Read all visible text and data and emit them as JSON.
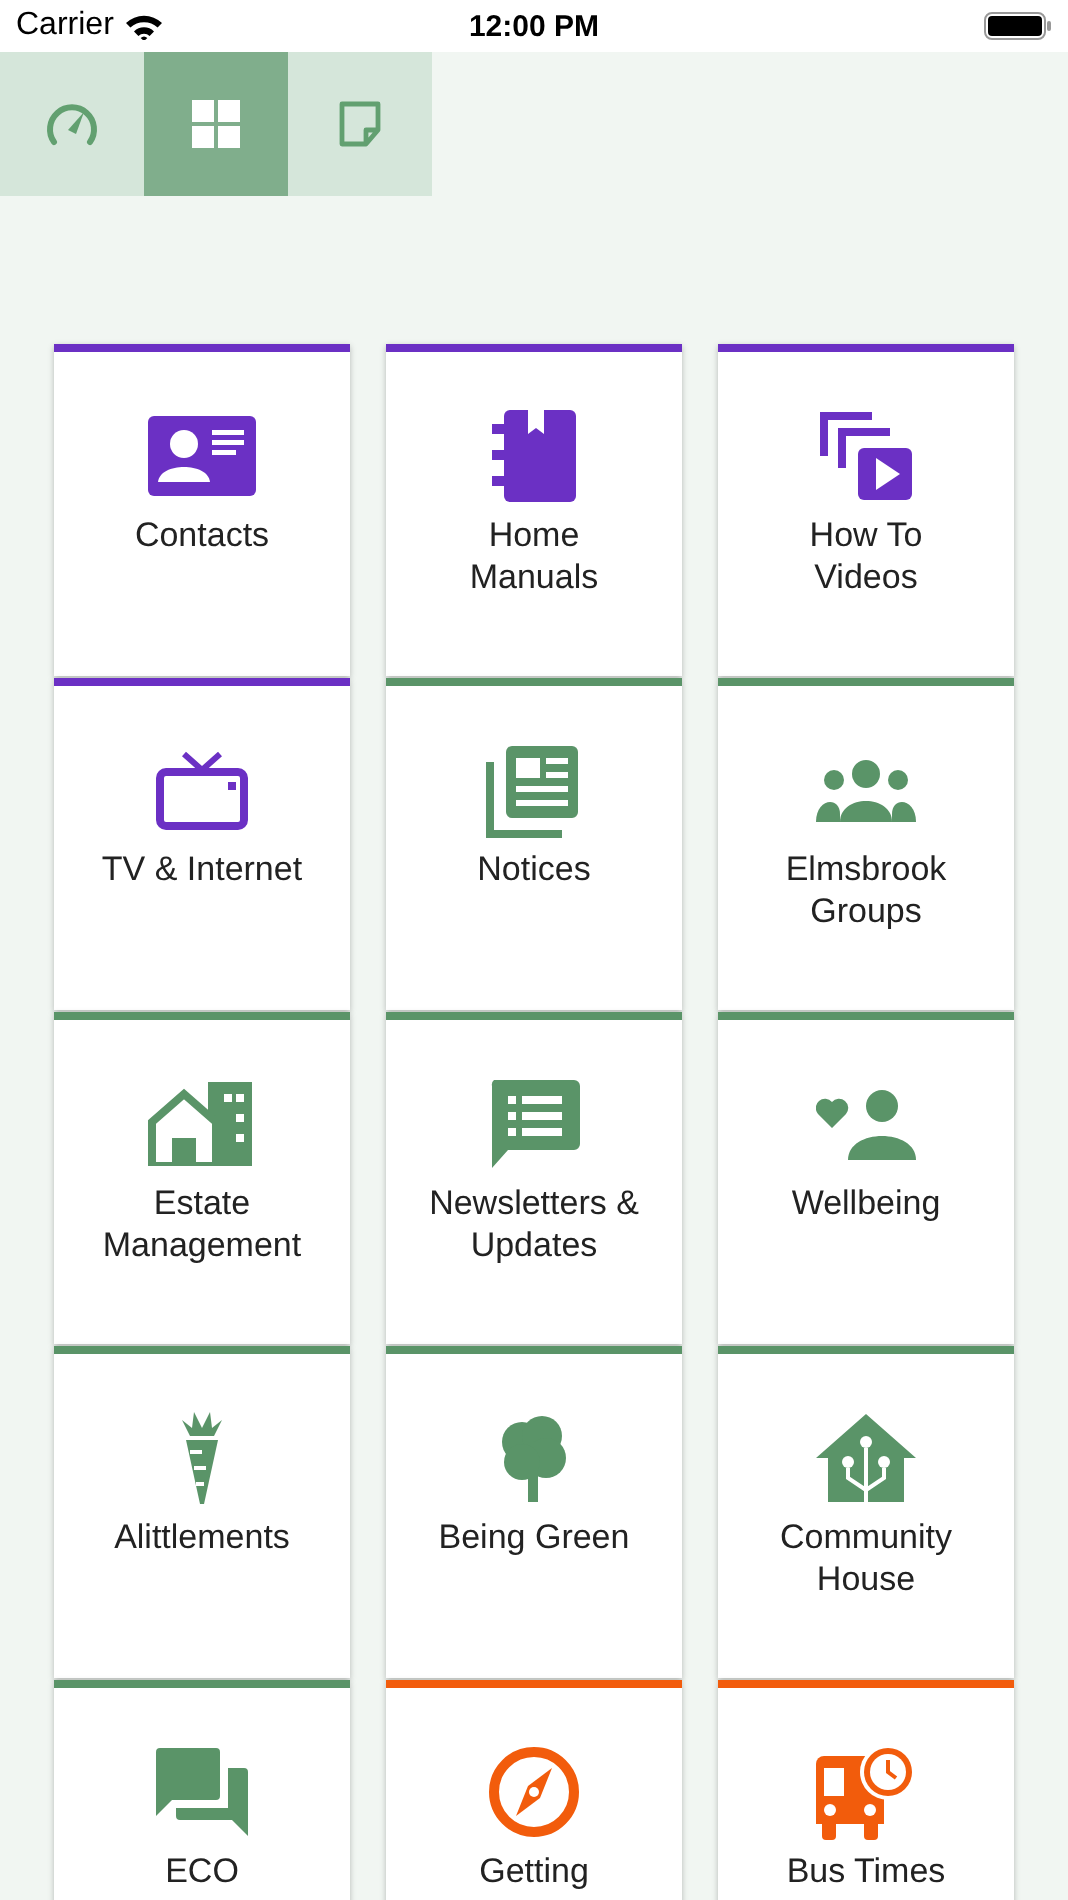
{
  "status_bar": {
    "carrier": "Carrier",
    "time": "12:00 PM"
  },
  "tabs": [
    {
      "selected": false
    },
    {
      "selected": true
    },
    {
      "selected": false
    }
  ],
  "tiles": [
    {
      "label": "Contacts",
      "color": "#6b30c4"
    },
    {
      "label": "Home\nManuals",
      "color": "#6b30c4"
    },
    {
      "label": "How To\nVideos",
      "color": "#6b30c4"
    },
    {
      "label": "TV & Internet",
      "color": "#6b30c4"
    },
    {
      "label": "Notices",
      "color": "#5a9468"
    },
    {
      "label": "Elmsbrook\nGroups",
      "color": "#5a9468"
    },
    {
      "label": "Estate\nManagement",
      "color": "#5a9468"
    },
    {
      "label": "Newsletters &\nUpdates",
      "color": "#5a9468"
    },
    {
      "label": "Wellbeing",
      "color": "#5a9468"
    },
    {
      "label": "Alittlements",
      "color": "#5a9468"
    },
    {
      "label": "Being Green",
      "color": "#5a9468"
    },
    {
      "label": "Community\nHouse",
      "color": "#5a9468"
    },
    {
      "label": "ECO",
      "color": "#5a9468"
    },
    {
      "label": "Getting",
      "color": "#f25c0c"
    },
    {
      "label": "Bus Times",
      "color": "#f25c0c"
    }
  ]
}
